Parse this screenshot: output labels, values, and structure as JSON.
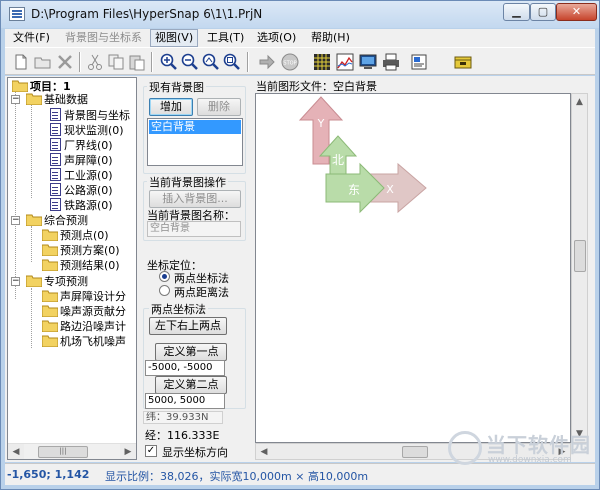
{
  "window": {
    "title": "D:\\Program Files\\HyperSnap 6\\1\\1.PrjN"
  },
  "menu": [
    {
      "label": "文件(F)",
      "state": "normal"
    },
    {
      "label": "背景图与坐标系",
      "state": "disabled"
    },
    {
      "label": "视图(V)",
      "state": "active"
    },
    {
      "label": "工具(T)",
      "state": "normal"
    },
    {
      "label": "选项(O)",
      "state": "normal"
    },
    {
      "label": "帮助(H)",
      "state": "normal"
    }
  ],
  "toolbar": [
    "new-file-icon",
    "open-folder-icon",
    "delete-icon",
    "cut-icon",
    "copy-icon",
    "paste-icon",
    "zoom-in-icon",
    "zoom-out-icon",
    "zoom-fit-icon",
    "zoom-all-icon",
    "arrow-right-icon",
    "stop-icon",
    "grid-icon",
    "chart-icon",
    "monitor-icon",
    "print-icon",
    "settings-icon",
    "help-book-icon"
  ],
  "tree": {
    "root": "项目：1",
    "groups": [
      {
        "label": "基础数据",
        "items": [
          "背景图与坐标",
          "现状监测(0)",
          "厂界线(0)",
          "声屏障(0)",
          "工业源(0)",
          "公路源(0)",
          "铁路源(0)"
        ]
      },
      {
        "label": "综合预测",
        "items": [
          "预测点(0)",
          "预测方案(0)",
          "预测结果(0)"
        ]
      },
      {
        "label": "专项预测",
        "items": [
          "声屏障设计分",
          "噪声源贡献分",
          "路边沿噪声计",
          "机场飞机噪声"
        ]
      }
    ]
  },
  "bg_panel": {
    "existing_title": "现有背景图",
    "add_button": "增加",
    "remove_button": "删除",
    "list_items": [
      "空白背景"
    ],
    "ops_title": "当前背景图操作",
    "insert_button": "插入背景图...",
    "name_label": "当前背景图名称：",
    "name_value": "空白背景",
    "coord_title": "坐标定位：",
    "radio_two_point": "两点坐标法",
    "radio_two_distance": "两点距离法",
    "two_point_title": "两点坐标法",
    "lower_left_button": "左下右上两点",
    "define_first_button": "定义第一点",
    "first_point_value": "-5000, -5000",
    "define_second_button": "定义第二点",
    "second_point_value": "5000, 5000",
    "latitude_label": "纬：39.933N",
    "longitude_label": "经：116.333E",
    "show_direction_label": "显示坐标方向",
    "show_direction_checked": true
  },
  "canvas": {
    "label": "当前图形文件：空白背景",
    "north_label": "北",
    "east_label": "东",
    "y_label": "Y",
    "x_label": "X"
  },
  "status": {
    "coords": "-1,650; 1,142",
    "scale": "显示比例：38,026，实际宽10,000m × 高10,000m"
  },
  "watermark": {
    "text": "当下软件园",
    "url": "www.downxia.com"
  },
  "colors": {
    "y_arrow": "#e5b2b7",
    "north_arrow": "#b9dca9",
    "x_arrow": "#e0c7c6",
    "selection": "#3399ff"
  }
}
